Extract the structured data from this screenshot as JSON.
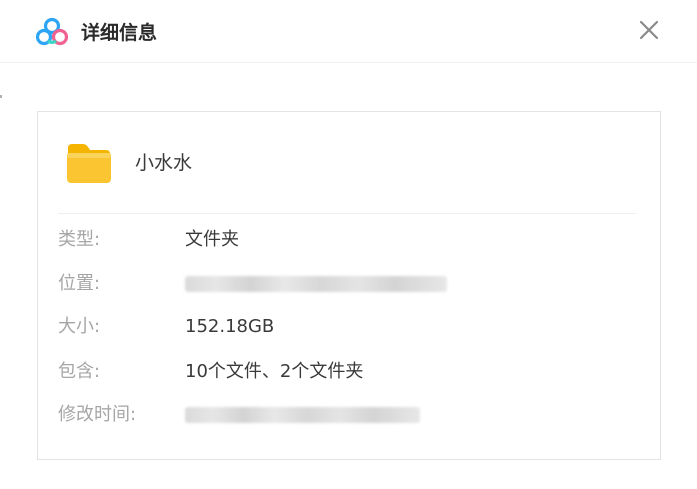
{
  "dialog": {
    "title": "详细信息",
    "logo_icon": "baidu-netdisk-logo-icon",
    "close_icon": "close-icon"
  },
  "item": {
    "icon": "folder-icon",
    "name": "小水水"
  },
  "details": [
    {
      "label": "类型:",
      "value": "文件夹"
    },
    {
      "label": "位置:",
      "value": ""
    },
    {
      "label": "大小:",
      "value": "152.18GB"
    },
    {
      "label": "包含:",
      "value": "10个文件、2个文件夹"
    },
    {
      "label": "修改时间:",
      "value": ""
    }
  ],
  "colors": {
    "folder": "#F9C333",
    "logo_blue": "#2DA5F5",
    "logo_pink": "#F06292",
    "logo_cyan": "#3BD6C6"
  }
}
